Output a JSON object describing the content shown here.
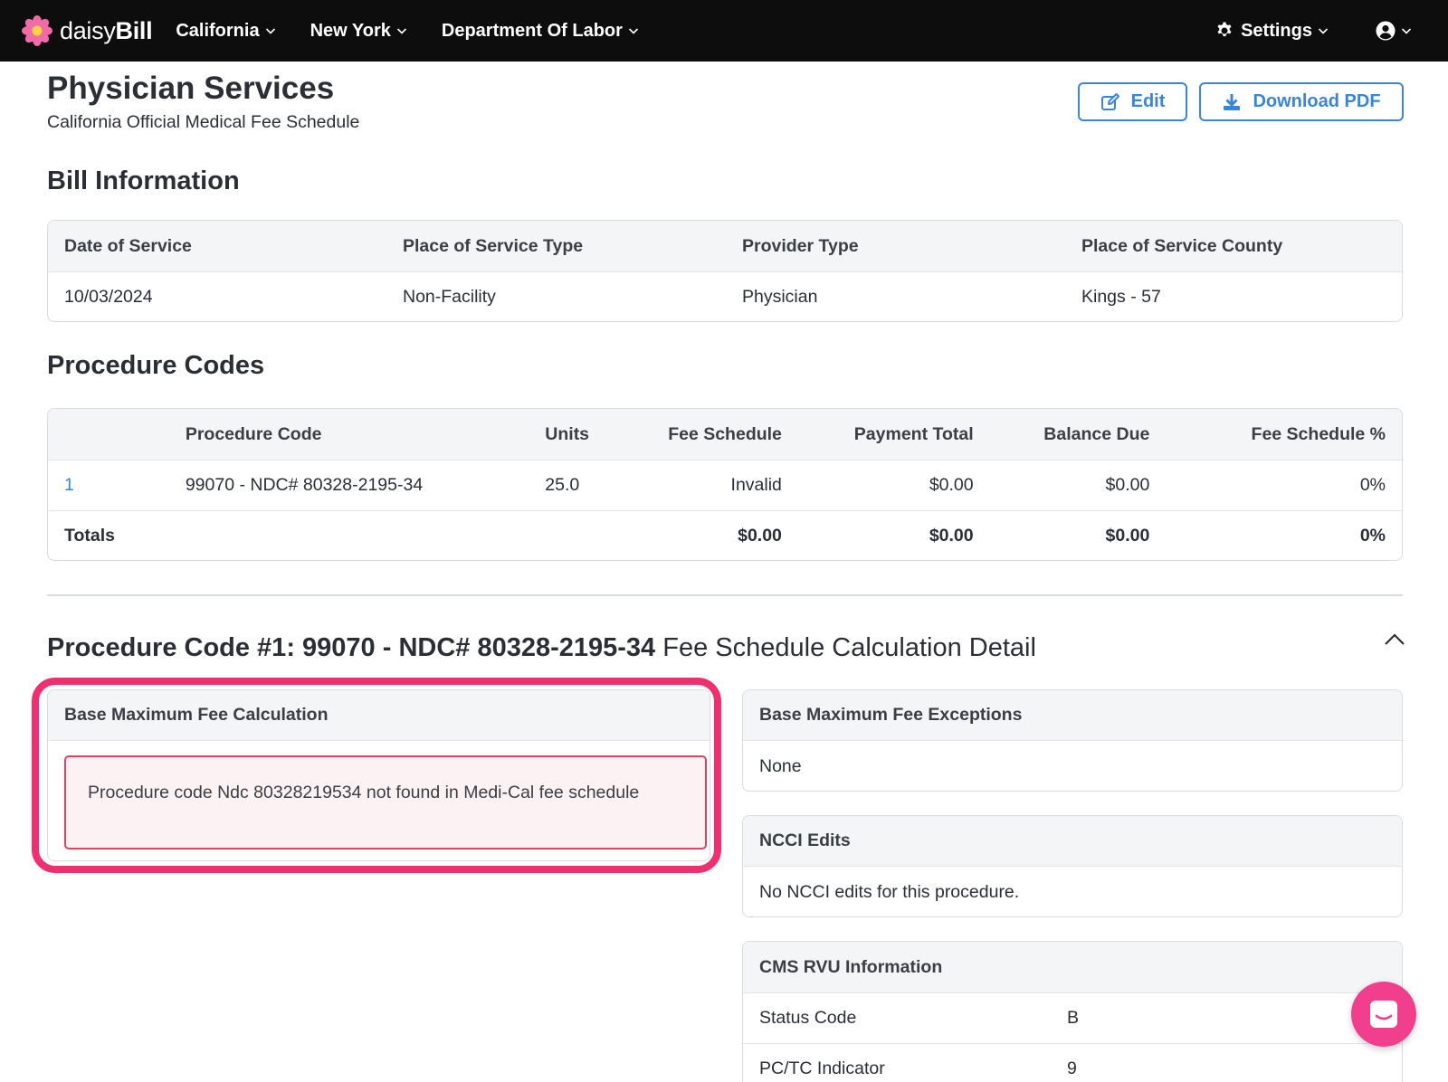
{
  "nav": {
    "brand_light": "daisy",
    "brand_bold": "Bill",
    "items": [
      "California",
      "New York",
      "Department Of Labor"
    ],
    "settings": "Settings",
    "icons": {
      "logo": "daisy-flower-icon",
      "settings": "gear-icon",
      "user": "user-circle-icon"
    }
  },
  "header": {
    "title": "Physician Services",
    "subtitle": "California Official Medical Fee Schedule",
    "edit_label": "Edit",
    "pdf_label": "Download PDF"
  },
  "bill_info": {
    "title": "Bill Information",
    "columns": [
      "Date of Service",
      "Place of Service Type",
      "Provider Type",
      "Place of Service County"
    ],
    "values": [
      "10/03/2024",
      "Non-Facility",
      "Physician",
      "Kings - 57"
    ]
  },
  "procedure_codes": {
    "title": "Procedure Codes",
    "columns": [
      "",
      "Procedure Code",
      "Units",
      "Fee Schedule",
      "Payment Total",
      "Balance Due",
      "Fee Schedule %"
    ],
    "rows": [
      [
        "1",
        "99070 - NDC# 80328-2195-34",
        "25.0",
        "Invalid",
        "$0.00",
        "$0.00",
        "0%"
      ]
    ],
    "totals": [
      "Totals",
      "",
      "",
      "$0.00",
      "$0.00",
      "$0.00",
      "0%"
    ]
  },
  "detail": {
    "title_bold": "Procedure Code #1: 99070 - NDC# 80328-2195-34",
    "title_rest": " Fee Schedule Calculation Detail",
    "base_calc": {
      "title": "Base Maximum Fee Calculation",
      "error": "Procedure code Ndc 80328219534 not found in Medi-Cal fee schedule"
    },
    "exceptions": {
      "title": "Base Maximum Fee Exceptions",
      "value": "None"
    },
    "ncci": {
      "title": "NCCI Edits",
      "value": "No NCCI edits for this procedure."
    },
    "cms_rvu": {
      "title": "CMS RVU Information",
      "rows": [
        {
          "k": "Status Code",
          "v": "B"
        },
        {
          "k": "PC/TC Indicator",
          "v": "9"
        }
      ]
    }
  },
  "colors": {
    "accent": "#3a86d6",
    "error_border": "#e0435e",
    "highlight": "#f0306e",
    "chat": "#f23f8d"
  }
}
